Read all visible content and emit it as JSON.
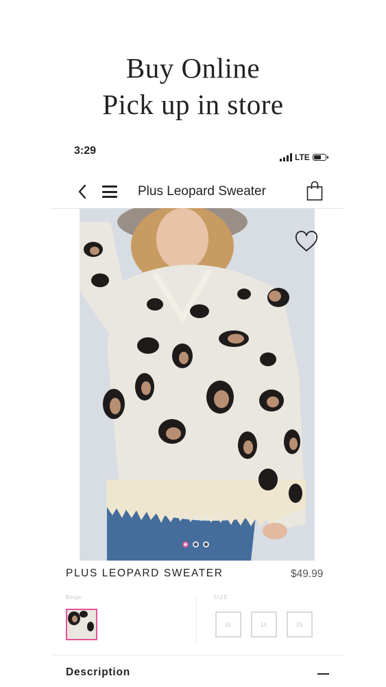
{
  "headline": {
    "line1": "Buy Online",
    "line2": "Pick up in store"
  },
  "status_bar": {
    "time": "3:29",
    "network": "LTE",
    "battery_level": 0.65
  },
  "nav": {
    "back_icon": "chevron-left-icon",
    "menu_icon": "hamburger-menu-icon",
    "title": "Plus Leopard Sweater",
    "bag_icon": "shopping-bag-icon"
  },
  "product": {
    "name": "PLUS LEOPARD SWEATER",
    "price": "$49.99",
    "image_count": 3,
    "active_image": 1,
    "favorite_icon": "heart-outline-icon"
  },
  "options": {
    "color_label": "Beige",
    "size_label": "SIZE",
    "sizes": [
      "XL",
      "1X",
      "2X"
    ]
  },
  "description": {
    "label": "Description",
    "toggle_icon": "minus-icon"
  },
  "colors": {
    "accent": "#e4549a",
    "dot_inactive": "#3f4a5a",
    "sweater": "#e9e7df",
    "leopard_dark": "#1e1b1a",
    "leopard_tan": "#b98f73"
  }
}
